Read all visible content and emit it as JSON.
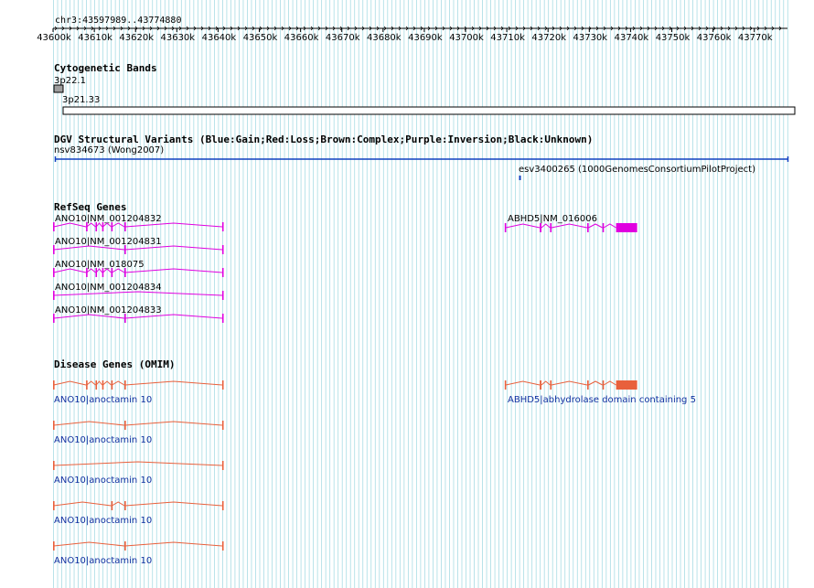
{
  "browser": {
    "region": "chr3:43597989..43774880",
    "axis_ticks": [
      "43600k",
      "43610k",
      "43620k",
      "43630k",
      "43640k",
      "43650k",
      "43660k",
      "43670k",
      "43680k",
      "43690k",
      "43700k",
      "43710k",
      "43720k",
      "43730k",
      "43740k",
      "43750k",
      "43760k",
      "43770k"
    ],
    "colors": {
      "grid": "#a8dce4",
      "background": "#ffffff",
      "text": "#000000",
      "refseq": "#e000e0",
      "omim": "#e8603c",
      "dgv": "#1040c0",
      "link": "#1030a0"
    }
  },
  "tracks": {
    "cytoband": {
      "title": "Cytogenetic Bands",
      "bands": [
        {
          "name": "3p22.1",
          "start": 43480000,
          "end": 43600000
        },
        {
          "name": "3p21.33",
          "start": 43600000,
          "end": 44100000
        }
      ]
    },
    "dgv": {
      "title": "DGV Structural Variants (Blue:Gain;Red:Loss;Brown:Complex;Purple:Inversion;Black:Unknown)",
      "features": [
        {
          "name": "nsv834673 (Wong2007)",
          "start": 43597989,
          "end": 43774880,
          "color": "#1040c0"
        },
        {
          "name": "esv3400265 (1000GenomesConsortiumPilotProject)",
          "start": 43711500,
          "end": 43712200,
          "color": "#1040c0"
        }
      ]
    },
    "refseq": {
      "title": "RefSeq Genes",
      "features": [
        {
          "name": "ANO10|NM_001204832",
          "start": 43600000,
          "end": 43641200,
          "strand": "-",
          "exons": [
            [
              43600000,
              43600180
            ],
            [
              43608000,
              43608180
            ],
            [
              43610300,
              43610480
            ],
            [
              43611900,
              43612080
            ],
            [
              43614100,
              43614280
            ],
            [
              43617300,
              43617480
            ],
            [
              43641000,
              43641200
            ]
          ]
        },
        {
          "name": "ANO10|NM_001204831",
          "start": 43600000,
          "end": 43641200,
          "strand": "-",
          "exons": [
            [
              43600000,
              43600180
            ],
            [
              43617300,
              43617480
            ],
            [
              43641000,
              43641200
            ]
          ]
        },
        {
          "name": "ANO10|NM_018075",
          "start": 43600000,
          "end": 43641200,
          "strand": "-",
          "exons": [
            [
              43600000,
              43600180
            ],
            [
              43608000,
              43608180
            ],
            [
              43610300,
              43610480
            ],
            [
              43611900,
              43612080
            ],
            [
              43614100,
              43614280
            ],
            [
              43617300,
              43617480
            ],
            [
              43641000,
              43641200
            ]
          ]
        },
        {
          "name": "ANO10|NM_001204834",
          "start": 43600000,
          "end": 43641200,
          "strand": "-",
          "exons": [
            [
              43600000,
              43600180
            ],
            [
              43641000,
              43641200
            ]
          ]
        },
        {
          "name": "ANO10|NM_001204833",
          "start": 43600000,
          "end": 43641200,
          "strand": "-",
          "exons": [
            [
              43600000,
              43600180
            ],
            [
              43617300,
              43617480
            ],
            [
              43641000,
              43641200
            ]
          ]
        },
        {
          "name": "ABHD5|NM_016006",
          "start": 43709500,
          "end": 43741600,
          "strand": "+",
          "exons": [
            [
              43709500,
              43709750
            ],
            [
              43718000,
              43718400
            ],
            [
              43720500,
              43720800
            ],
            [
              43729500,
              43729800
            ],
            [
              43733200,
              43733500
            ],
            [
              43736500,
              43741600
            ]
          ]
        }
      ]
    },
    "omim": {
      "title": "Disease Genes (OMIM)",
      "features": [
        {
          "name": "ANO10|anoctamin 10",
          "start": 43600000,
          "end": 43641200,
          "exons": [
            [
              43600000,
              43600180
            ],
            [
              43608000,
              43608180
            ],
            [
              43610300,
              43610480
            ],
            [
              43611900,
              43612080
            ],
            [
              43614100,
              43614280
            ],
            [
              43617300,
              43617480
            ],
            [
              43641000,
              43641200
            ]
          ]
        },
        {
          "name": "ANO10|anoctamin 10",
          "start": 43600000,
          "end": 43641200,
          "exons": [
            [
              43600000,
              43600180
            ],
            [
              43617300,
              43617480
            ],
            [
              43641000,
              43641200
            ]
          ]
        },
        {
          "name": "ANO10|anoctamin 10",
          "start": 43600000,
          "end": 43641200,
          "exons": [
            [
              43600000,
              43600180
            ],
            [
              43641000,
              43641200
            ]
          ]
        },
        {
          "name": "ANO10|anoctamin 10",
          "start": 43600000,
          "end": 43641200,
          "exons": [
            [
              43600000,
              43600180
            ],
            [
              43614100,
              43614280
            ],
            [
              43617300,
              43617480
            ],
            [
              43641000,
              43641200
            ]
          ]
        },
        {
          "name": "ANO10|anoctamin 10",
          "start": 43600000,
          "end": 43641200,
          "exons": [
            [
              43600000,
              43600180
            ],
            [
              43617300,
              43617480
            ],
            [
              43641000,
              43641200
            ]
          ]
        },
        {
          "name": "ABHD5|abhydrolase domain containing 5",
          "start": 43709500,
          "end": 43741600,
          "exons": [
            [
              43709500,
              43709750
            ],
            [
              43718000,
              43718400
            ],
            [
              43720500,
              43720800
            ],
            [
              43729500,
              43729800
            ],
            [
              43733200,
              43733500
            ],
            [
              43736500,
              43741600
            ]
          ]
        }
      ]
    }
  }
}
